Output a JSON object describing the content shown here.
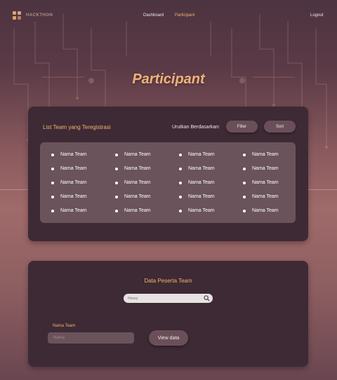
{
  "nav": {
    "logo_text": "HACKTHON",
    "links": [
      "Dashboard",
      "Participant"
    ],
    "active": "Participant",
    "logout": "Logout"
  },
  "page_title": "Participant",
  "team_list": {
    "title": "List Team yang Teregistrasi",
    "sort_label": "Urutkan Berdasarkan:",
    "filter_label": "Filter",
    "sort_button_label": "Sort",
    "columns": [
      [
        "Nama Team",
        "Nama Team",
        "Nama Team",
        "Nama Team",
        "Nama Team"
      ],
      [
        "Nama Team",
        "Nama Team",
        "Nama Team",
        "Nama Team",
        "Nama Team"
      ],
      [
        "Nama Team",
        "Nama Team",
        "Nama Team",
        "Nama Team",
        "Nama Team"
      ],
      [
        "Nama Team",
        "Nama Team",
        "Nama Team",
        "Nama Team",
        "Nama Team"
      ]
    ]
  },
  "data_peserta": {
    "title": "Data Peserta Team",
    "search_placeholder": "Honey",
    "field_label": "Nama Team",
    "name_placeholder": "Nama",
    "view_button": "View data"
  },
  "colors": {
    "accent": "#f2b36f",
    "card": "#3d2a35",
    "panel": "#6a535b"
  }
}
